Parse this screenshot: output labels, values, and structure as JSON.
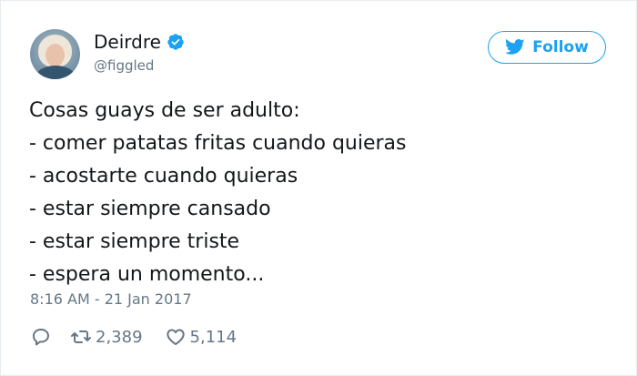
{
  "author": {
    "display_name": "Deirdre",
    "handle": "@figgled",
    "verified": true
  },
  "follow_button": {
    "label": "Follow",
    "icon": "twitter-bird-icon"
  },
  "tweet": {
    "lines": [
      "Cosas guays de ser adulto:",
      "- comer patatas fritas cuando quieras",
      "- acostarte cuando quieras",
      "- estar siempre cansado",
      "- estar siempre triste",
      "- espera un momento..."
    ],
    "timestamp": "8:16 AM - 21 Jan 2017"
  },
  "actions": {
    "reply_icon": "reply-icon",
    "retweet_icon": "retweet-icon",
    "retweet_count": "2,389",
    "like_icon": "heart-icon",
    "like_count": "5,114"
  },
  "colors": {
    "accent": "#1da1f2",
    "text": "#14171a",
    "muted": "#657786",
    "border": "#e6ecf0"
  }
}
